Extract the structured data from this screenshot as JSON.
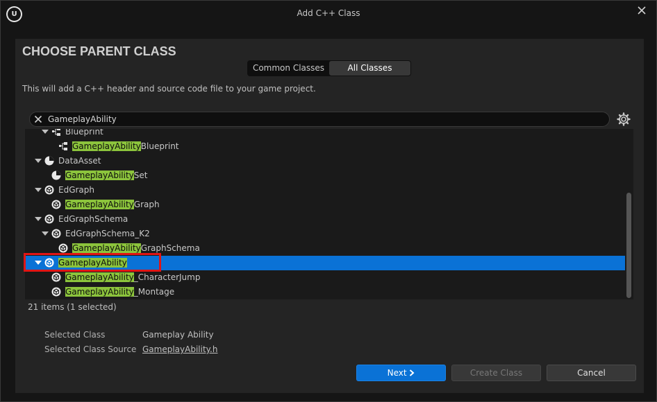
{
  "window": {
    "title": "Add C++ Class",
    "logo_text": "U"
  },
  "header": {
    "heading": "CHOOSE PARENT CLASS",
    "description": "This will add a C++ header and source code file to your game project."
  },
  "tabs": [
    {
      "label": "Common Classes",
      "active": false
    },
    {
      "label": "All Classes",
      "active": true
    }
  ],
  "search": {
    "value": "GameplayAbility"
  },
  "tree": {
    "rows": [
      {
        "pre": "",
        "match": "",
        "post": "Blueprint",
        "expanded": true,
        "icon": "blueprint-icon"
      },
      {
        "pre": "",
        "match": "GameplayAbility",
        "post": "Blueprint",
        "expanded": false,
        "icon": "blueprint-icon"
      },
      {
        "pre": "",
        "match": "",
        "post": "DataAsset",
        "expanded": true,
        "icon": "data-asset-icon"
      },
      {
        "pre": "",
        "match": "GameplayAbility",
        "post": "Set",
        "expanded": false,
        "icon": "data-asset-icon"
      },
      {
        "pre": "",
        "match": "",
        "post": "EdGraph",
        "expanded": true,
        "icon": "class-icon"
      },
      {
        "pre": "",
        "match": "GameplayAbility",
        "post": "Graph",
        "expanded": false,
        "icon": "class-icon"
      },
      {
        "pre": "",
        "match": "",
        "post": "EdGraphSchema",
        "expanded": true,
        "icon": "class-icon"
      },
      {
        "pre": "",
        "match": "",
        "post": "EdGraphSchema_K2",
        "expanded": true,
        "icon": "class-icon"
      },
      {
        "pre": "",
        "match": "GameplayAbility",
        "post": "GraphSchema",
        "expanded": false,
        "icon": "class-icon"
      },
      {
        "pre": "",
        "match": "GameplayAbility",
        "post": "",
        "expanded": true,
        "icon": "class-icon",
        "selected": true
      },
      {
        "pre": "",
        "match": "GameplayAbility",
        "post": "_CharacterJump",
        "expanded": false,
        "icon": "class-icon"
      },
      {
        "pre": "",
        "match": "GameplayAbility",
        "post": "_Montage",
        "expanded": false,
        "icon": "class-icon"
      }
    ],
    "item_count": "21 items (1 selected)"
  },
  "selection": {
    "class_label": "Selected Class",
    "class_value": "Gameplay Ability",
    "source_label": "Selected Class Source",
    "source_value": "GameplayAbility.h"
  },
  "buttons": {
    "next": "Next",
    "create": "Create Class",
    "cancel": "Cancel"
  },
  "colors": {
    "accent": "#0a72d6",
    "highlight": "#8cc43c",
    "selection_outline": "#e01515"
  }
}
